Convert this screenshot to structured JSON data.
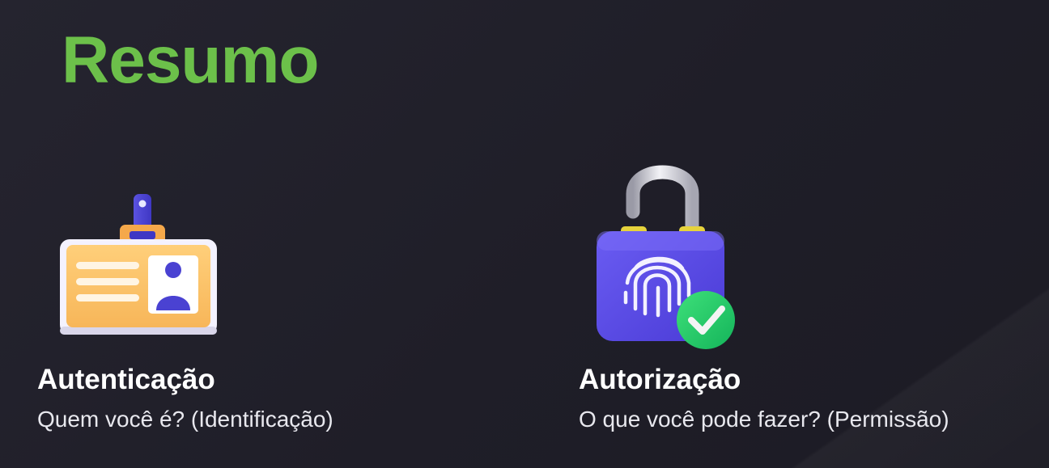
{
  "page": {
    "title": "Resumo"
  },
  "cards": [
    {
      "title": "Autenticação",
      "subtitle": "Quem você é? (Identificação)",
      "icon": "id-badge-icon"
    },
    {
      "title": "Autorização",
      "subtitle": "O que você pode fazer? (Permissão)",
      "icon": "fingerprint-padlock-icon"
    }
  ],
  "colors": {
    "accent": "#6cc04a",
    "background": "#22212b",
    "text": "#ffffff"
  }
}
